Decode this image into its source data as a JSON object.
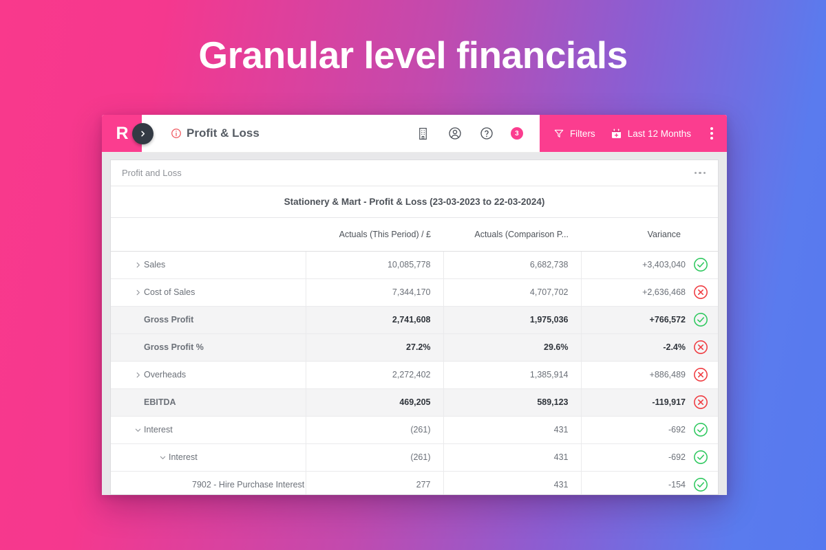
{
  "banner": {
    "title": "Granular level financials"
  },
  "topbar": {
    "logo": "R",
    "nav_toggle_icon": "chevron-right-icon",
    "info_icon": "info-circle-icon",
    "page_title": "Profit & Loss",
    "icons": [
      {
        "name": "building-icon",
        "glyph": "building"
      },
      {
        "name": "account-icon",
        "glyph": "user-circle"
      },
      {
        "name": "help-icon",
        "glyph": "question-circle"
      }
    ],
    "notification_count": "3",
    "filters_label": "Filters",
    "filters_icon": "filter-icon",
    "date_range_label": "Last 12 Months",
    "date_range_icon": "calendar-icon",
    "overflow_icon": "kebab-menu-icon"
  },
  "card": {
    "breadcrumb": "Profit and Loss",
    "overflow_icon": "ellipsis-horizontal-icon",
    "report_title": "Stationery & Mart - Profit & Loss (23-03-2023 to 22-03-2024)"
  },
  "table": {
    "headers": {
      "label": "",
      "col1": "Actuals (This Period) / £",
      "col2": "Actuals (Comparison P...",
      "col3": "Variance"
    },
    "rows": [
      {
        "label": "Sales",
        "indent": 0,
        "chevron": "right",
        "subtotal": false,
        "col1": "10,085,778",
        "col2": "6,682,738",
        "col3": "+3,403,040",
        "status": "check"
      },
      {
        "label": "Cost of Sales",
        "indent": 0,
        "chevron": "right",
        "subtotal": false,
        "col1": "7,344,170",
        "col2": "4,707,702",
        "col3": "+2,636,468",
        "status": "cross"
      },
      {
        "label": "Gross Profit",
        "indent": 0,
        "chevron": "none",
        "subtotal": true,
        "col1": "2,741,608",
        "col2": "1,975,036",
        "col3": "+766,572",
        "status": "check"
      },
      {
        "label": "Gross Profit %",
        "indent": 0,
        "chevron": "none",
        "subtotal": true,
        "col1": "27.2%",
        "col2": "29.6%",
        "col3": "-2.4%",
        "status": "cross"
      },
      {
        "label": "Overheads",
        "indent": 0,
        "chevron": "right",
        "subtotal": false,
        "col1": "2,272,402",
        "col2": "1,385,914",
        "col3": "+886,489",
        "status": "cross"
      },
      {
        "label": "EBITDA",
        "indent": 0,
        "chevron": "none",
        "subtotal": true,
        "col1": "469,205",
        "col2": "589,123",
        "col3": "-119,917",
        "status": "cross"
      },
      {
        "label": "Interest",
        "indent": 0,
        "chevron": "down",
        "subtotal": false,
        "col1": "(261)",
        "col2": "431",
        "col3": "-692",
        "status": "check"
      },
      {
        "label": "Interest",
        "indent": 1,
        "chevron": "down",
        "subtotal": false,
        "col1": "(261)",
        "col2": "431",
        "col3": "-692",
        "status": "check"
      },
      {
        "label": "7902 - Hire Purchase Interest",
        "indent": 2,
        "chevron": "none",
        "subtotal": false,
        "col1": "277",
        "col2": "431",
        "col3": "-154",
        "status": "check"
      }
    ]
  },
  "colors": {
    "brand_pink": "#fb3d8f",
    "gradient_start": "#f9398c",
    "gradient_end": "#5679ef",
    "status_positive": "#2fc85f",
    "status_negative": "#ef3b40",
    "dark_navy": "#333a44"
  }
}
